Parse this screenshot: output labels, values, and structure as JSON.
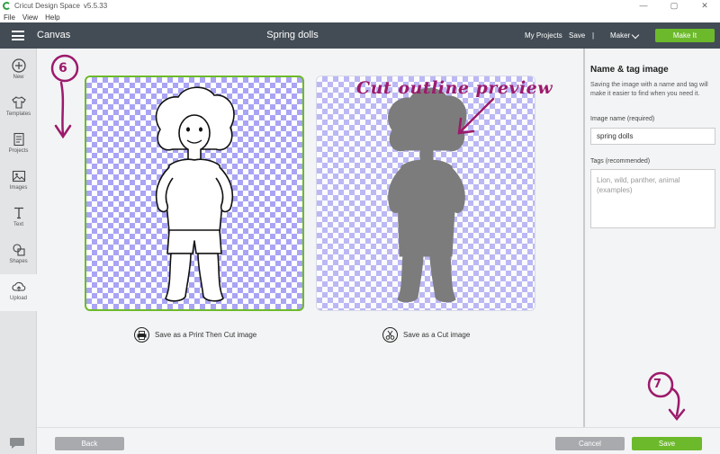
{
  "window": {
    "app_title": "Cricut Design Space",
    "version": "v5.5.33",
    "controls": [
      "—",
      "▢",
      "✕"
    ]
  },
  "menu": [
    "File",
    "View",
    "Help"
  ],
  "header": {
    "canvas_label": "Canvas",
    "project_name": "Spring dolls",
    "my_projects": "My Projects",
    "save": "Save",
    "separator": "|",
    "maker": "Maker",
    "make_it": "Make It"
  },
  "toolbar": [
    {
      "label": "New",
      "icon": "plus-icon"
    },
    {
      "label": "Templates",
      "icon": "shirt-icon"
    },
    {
      "label": "Projects",
      "icon": "projects-icon"
    },
    {
      "label": "Images",
      "icon": "image-icon"
    },
    {
      "label": "Text",
      "icon": "text-icon"
    },
    {
      "label": "Shapes",
      "icon": "shapes-icon"
    },
    {
      "label": "Upload",
      "icon": "upload-icon"
    }
  ],
  "options": {
    "print_then_cut": "Save as a Print Then Cut image",
    "cut": "Save as a Cut image"
  },
  "panel": {
    "title": "Name & tag image",
    "description": "Saving the image with a name and tag will make it easier to find when you need it.",
    "name_label": "Image name (required)",
    "name_value": "spring dolls",
    "tags_label": "Tags (recommended)",
    "tags_placeholder": "Lion, wild, panther, animal (examples)"
  },
  "footer": {
    "back": "Back",
    "cancel": "Cancel",
    "save": "Save"
  },
  "annotations": {
    "step_6": "6",
    "step_7": "7",
    "cut_preview_note": "Cut outline preview"
  },
  "colors": {
    "header_bg": "#434c55",
    "accent_green": "#6cba2b",
    "checker_purple": "#a9a4f4",
    "annotation_magenta": "#9c1a6c",
    "silhouette": "#555555"
  }
}
